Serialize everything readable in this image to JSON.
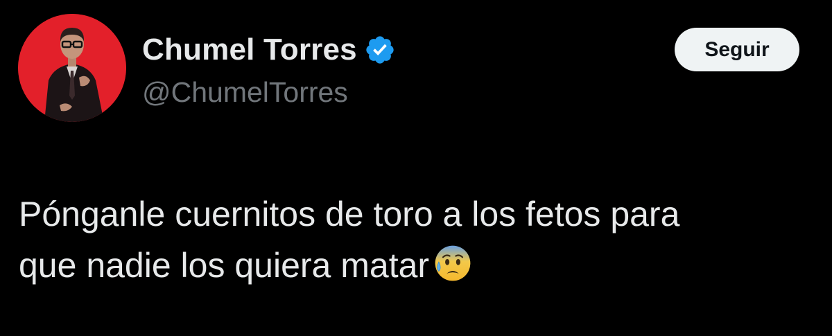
{
  "author": {
    "display_name": "Chumel Torres",
    "handle": "@ChumelTorres",
    "verified_icon": "verified-badge-icon",
    "avatar_bg_color": "#e3202a",
    "verified_color": "#1d9bf0"
  },
  "actions": {
    "follow_label": "Seguir"
  },
  "tweet": {
    "line_1": "Pónganle cuernitos de toro a los fetos para",
    "line_2": "que nadie los quiera matar",
    "emoji_icon": "anxious-face-with-sweat-emoji"
  },
  "colors": {
    "background": "#000000",
    "primary_text": "#e7e9ea",
    "secondary_text": "#71767b",
    "button_bg": "#eff3f4"
  }
}
